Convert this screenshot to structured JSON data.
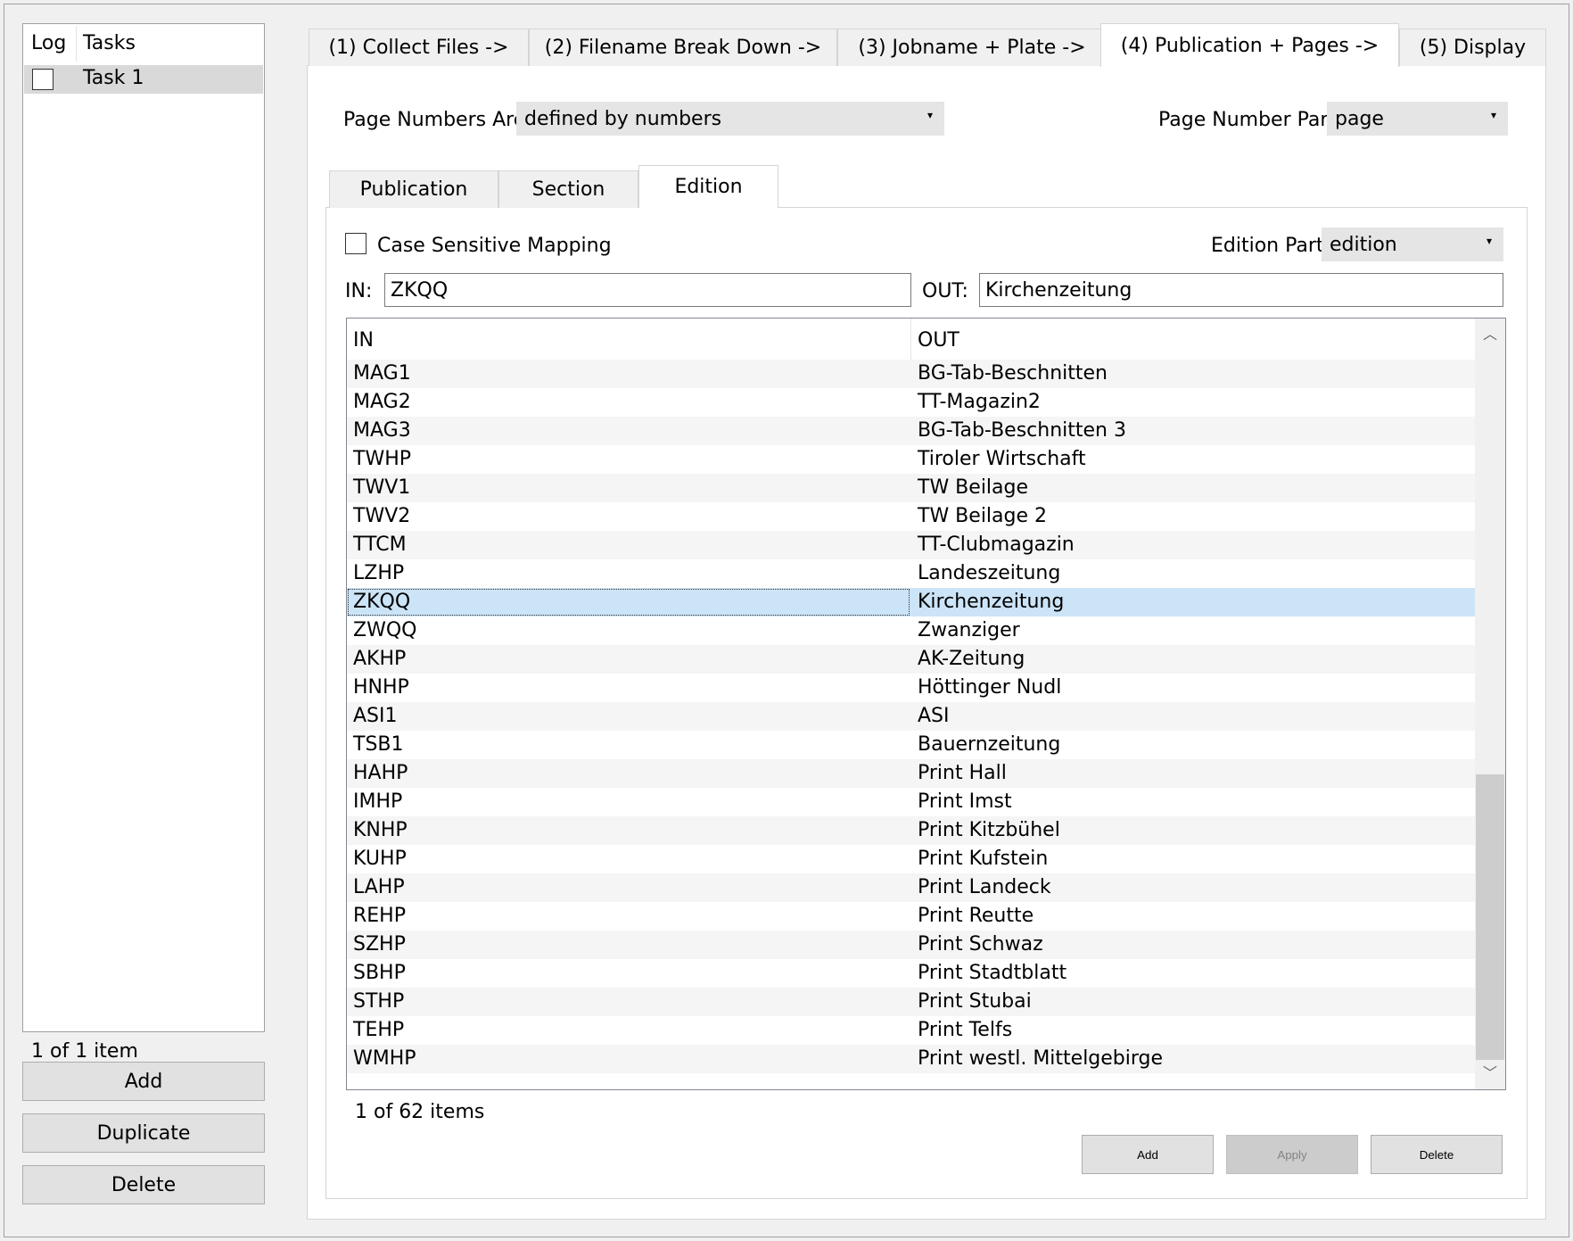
{
  "left_panel": {
    "columns": {
      "log": "Log",
      "tasks": "Tasks"
    },
    "tasks": [
      {
        "label": "Task 1",
        "checked": false
      }
    ],
    "count": "1 of 1 item",
    "buttons": {
      "add": "Add",
      "duplicate": "Duplicate",
      "delete": "Delete"
    }
  },
  "steps": [
    "(1) Collect Files ->",
    "(2) Filename Break Down ->",
    "(3) Jobname + Plate ->",
    "(4) Publication + Pages ->",
    "(5) Display"
  ],
  "active_step": 3,
  "page_numbers": {
    "label": "Page Numbers Are",
    "value": "defined by numbers",
    "part_label": "Page Number Part",
    "part_value": "page"
  },
  "subtabs": [
    "Publication",
    "Section",
    "Edition"
  ],
  "active_subtab": 2,
  "edition": {
    "case_sensitive_label": "Case Sensitive Mapping",
    "case_sensitive": false,
    "part_label": "Edition Part",
    "part_value": "edition",
    "in_label": "IN:",
    "in_value": "ZKQQ",
    "out_label": "OUT:",
    "out_value": "Kirchenzeitung"
  },
  "table": {
    "headers": {
      "in": "IN",
      "out": "OUT"
    },
    "rows": [
      [
        "MAG1",
        "BG-Tab-Beschnitten"
      ],
      [
        "MAG2",
        "TT-Magazin2"
      ],
      [
        "MAG3",
        "BG-Tab-Beschnitten 3"
      ],
      [
        "TWHP",
        "Tiroler Wirtschaft"
      ],
      [
        "TWV1",
        "TW Beilage"
      ],
      [
        "TWV2",
        "TW Beilage 2"
      ],
      [
        "TTCM",
        "TT-Clubmagazin"
      ],
      [
        "LZHP",
        "Landeszeitung"
      ],
      [
        "ZKQQ",
        "Kirchenzeitung"
      ],
      [
        "ZWQQ",
        "Zwanziger"
      ],
      [
        "AKHP",
        "AK-Zeitung"
      ],
      [
        "HNHP",
        "Höttinger Nudl"
      ],
      [
        "ASI1",
        "ASI"
      ],
      [
        "TSB1",
        "Bauernzeitung"
      ],
      [
        "HAHP",
        "Print Hall"
      ],
      [
        "IMHP",
        "Print Imst"
      ],
      [
        "KNHP",
        "Print Kitzbühel"
      ],
      [
        "KUHP",
        "Print Kufstein"
      ],
      [
        "LAHP",
        "Print Landeck"
      ],
      [
        "REHP",
        "Print Reutte"
      ],
      [
        "SZHP",
        "Print Schwaz"
      ],
      [
        "SBHP",
        "Print Stadtblatt"
      ],
      [
        "STHP",
        "Print Stubai"
      ],
      [
        "TEHP",
        "Print Telfs"
      ],
      [
        "WMHP",
        "Print westl. Mittelgebirge"
      ]
    ],
    "selected_index": 8,
    "count": "1 of 62 items"
  },
  "buttons": {
    "add": "Add",
    "apply": "Apply",
    "delete": "Delete"
  }
}
